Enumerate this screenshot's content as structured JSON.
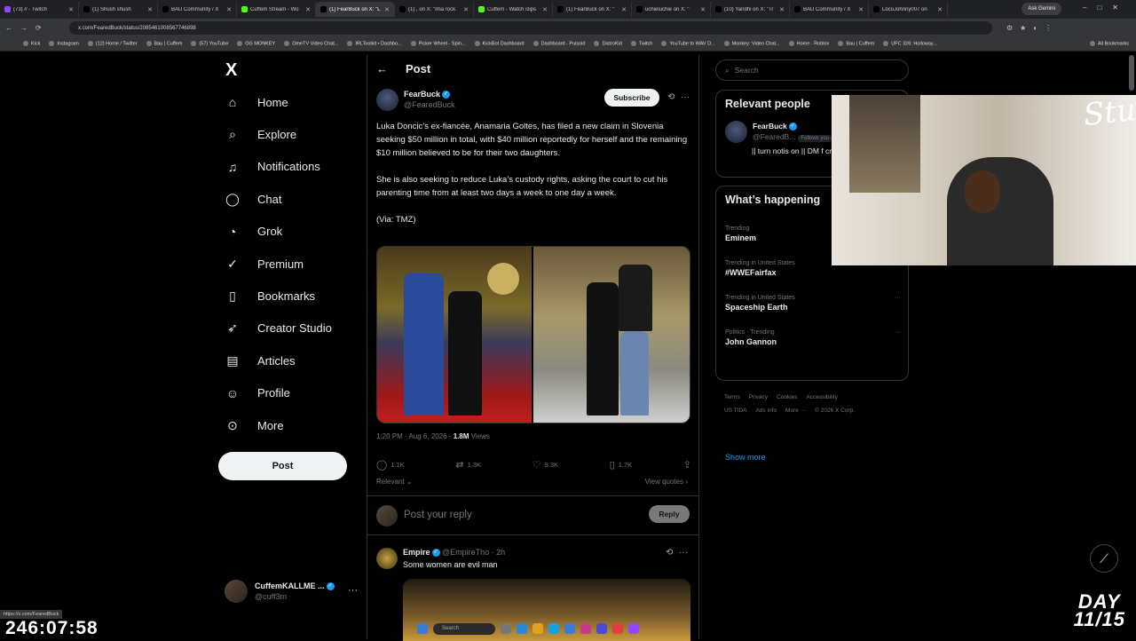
{
  "browser": {
    "tabs": [
      {
        "label": "(73) // - Twitch",
        "color": "#9146ff"
      },
      {
        "label": "(1) Shush shush",
        "color": "#000000"
      },
      {
        "label": "BAU Community / X",
        "color": "#000000"
      },
      {
        "label": "Cuffem Stream - Wo",
        "color": "#53fc18"
      },
      {
        "label": "(1) FearBuck on X: \"L",
        "color": "#000000",
        "active": true
      },
      {
        "label": "(1) , on X: \"Ima rock",
        "color": "#000000"
      },
      {
        "label": "Cuffem - Watch clips",
        "color": "#53fc18"
      },
      {
        "label": "(1) FearBuck on X: \"",
        "color": "#000000"
      },
      {
        "label": "uchieluchie on X: \"",
        "color": "#000000"
      },
      {
        "label": "(10) Yandhi on X: \"Tr",
        "color": "#000000"
      },
      {
        "label": "BAU Community / X",
        "color": "#000000"
      },
      {
        "label": "LocoJohnny007 on",
        "color": "#000000"
      }
    ],
    "ask_gemini": "Ask Gemini",
    "url": "x.com/FearedBuck/status/2085461008567746898",
    "bookmarks": [
      "Kick",
      "Instagram",
      "(12) Home / Twitter",
      "Bau | Cuffem",
      "(57) YouTube",
      "OG MONKEY",
      "OmeTV Video Chat...",
      "IRLToolkit • Dashbo...",
      "Picker Wheel - Spin...",
      "KickBot Dashboard",
      "Dashboard - Pulsoid",
      "DistroKid",
      "Twitch",
      "YouTube to WAV D...",
      "Monkey: Video Chat...",
      "Home - Roblox",
      "Bau | Cuffem",
      "UFC 326: Holloway..."
    ],
    "all_bookmarks": "All Bookmarks"
  },
  "sidebar": {
    "logo": "X",
    "items": [
      {
        "label": "Home",
        "icon": "home-icon",
        "glyph": "⌂"
      },
      {
        "label": "Explore",
        "icon": "search-icon",
        "glyph": "⌕"
      },
      {
        "label": "Notifications",
        "icon": "bell-icon",
        "glyph": "♫"
      },
      {
        "label": "Chat",
        "icon": "chat-icon",
        "glyph": "◯"
      },
      {
        "label": "Grok",
        "icon": "grok-icon",
        "glyph": "◔"
      },
      {
        "label": "Premium",
        "icon": "verified-icon",
        "glyph": "✓"
      },
      {
        "label": "Bookmarks",
        "icon": "bookmark-icon",
        "glyph": "▯"
      },
      {
        "label": "Creator Studio",
        "icon": "rocket-icon",
        "glyph": "➶"
      },
      {
        "label": "Articles",
        "icon": "article-icon",
        "glyph": "▤"
      },
      {
        "label": "Profile",
        "icon": "person-icon",
        "glyph": "☺"
      },
      {
        "label": "More",
        "icon": "more-circle-icon",
        "glyph": "⊙"
      }
    ],
    "post_label": "Post",
    "account": {
      "name": "CuffemKALLME ...",
      "handle": "@cuff3m"
    }
  },
  "post": {
    "header": "Post",
    "author": {
      "name": "FearBuck",
      "handle": "@FearedBuck"
    },
    "subscribe_label": "Subscribe",
    "paragraphs": [
      "Luka Doncic’s ex-fiancée, Anamaria Goltes, has filed a new claim in Slovenia seeking $50 million in total, with $40 million reportedly for herself and the remaining $10 million believed to be for their two daughters.",
      "She is also seeking to reduce Luka’s custody rights, asking the court to cut his parenting time from at least two days a week to one day a week.",
      "(Via: TMZ)"
    ],
    "time": "1:20 PM · Aug 6, 2026 · ",
    "views_count": "1.8M",
    "views_label": " Views",
    "stats": {
      "replies": "1.1K",
      "reposts": "1.3K",
      "likes": "9.3K",
      "bookmarks": "1.7K"
    },
    "relevant_label": "Relevant",
    "view_quotes": "View quotes"
  },
  "reply_box": {
    "placeholder": "Post your reply",
    "button": "Reply"
  },
  "reply": {
    "name": "Empire",
    "handle": "@EmpireTho · 2h",
    "text": "Some women are evil man"
  },
  "right": {
    "search_placeholder": "Search",
    "relevant_people": {
      "title": "Relevant people",
      "name": "FearBuck",
      "handle": "@FearedB...",
      "follows_you": "Follows you",
      "bio": "|| turn notis on || DM f credit ||"
    },
    "happening": {
      "title": "What’s happening",
      "trends": [
        {
          "context": "Trending",
          "name": "Eminem"
        },
        {
          "context": "Trending in United States",
          "name": "#WWEFairfax"
        },
        {
          "context": "Trending in United States",
          "name": "Spaceship Earth"
        },
        {
          "context": "Politics · Trending",
          "name": "John Gannon"
        }
      ],
      "show_more": "Show more"
    },
    "footer": [
      "Terms",
      "Privacy",
      "Cookies",
      "Accessibility",
      "US TIDA",
      "Ads info",
      "More ···",
      "© 2026 X Corp."
    ]
  },
  "overlay": {
    "status_url": "https://x.com/FearedBuck",
    "clock": "246:07:58",
    "day_line1": "DAY",
    "day_line2": "11/15",
    "taskbar_search": "Search",
    "cam_sign": "Stu"
  }
}
